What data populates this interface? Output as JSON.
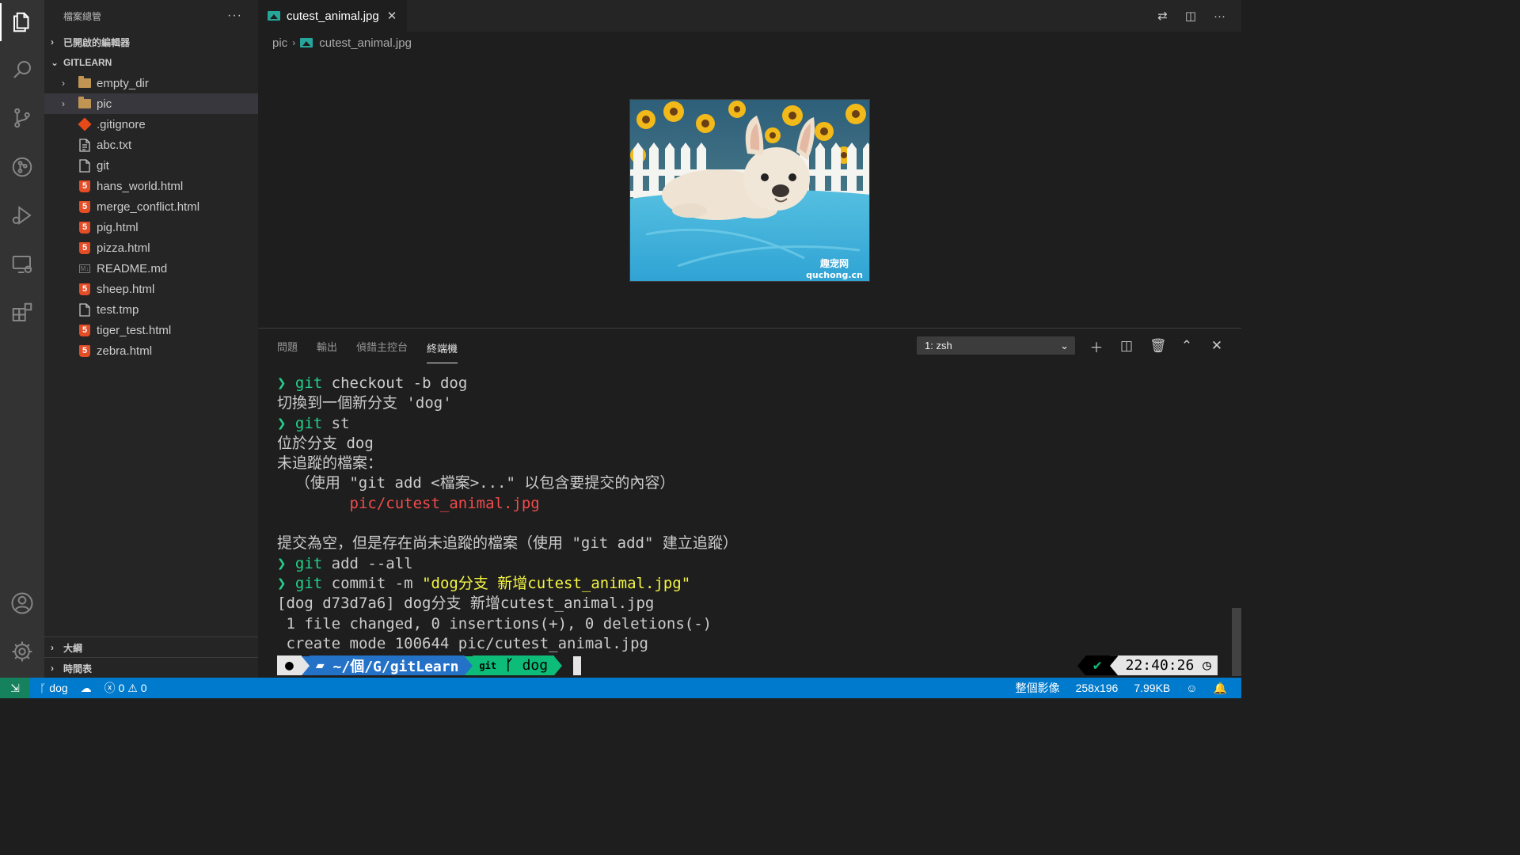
{
  "sidebar": {
    "title": "檔案總管",
    "more": "···",
    "open_editors": "已開啟的編輯器",
    "project": "GITLEARN",
    "outline": "大綱",
    "timeline": "時間表",
    "items": [
      {
        "name": "empty_dir",
        "type": "folder"
      },
      {
        "name": "pic",
        "type": "folder"
      },
      {
        "name": ".gitignore",
        "type": "git"
      },
      {
        "name": "abc.txt",
        "type": "text"
      },
      {
        "name": "git",
        "type": "file"
      },
      {
        "name": "hans_world.html",
        "type": "html"
      },
      {
        "name": "merge_conflict.html",
        "type": "html"
      },
      {
        "name": "pig.html",
        "type": "html"
      },
      {
        "name": "pizza.html",
        "type": "html"
      },
      {
        "name": "README.md",
        "type": "md"
      },
      {
        "name": "sheep.html",
        "type": "html"
      },
      {
        "name": "test.tmp",
        "type": "file"
      },
      {
        "name": "tiger_test.html",
        "type": "html"
      },
      {
        "name": "zebra.html",
        "type": "html"
      }
    ]
  },
  "editor": {
    "tab_label": "cutest_animal.jpg",
    "breadcrumb_folder": "pic",
    "breadcrumb_file": "cutest_animal.jpg",
    "image_watermark_line1": "趣宠网",
    "image_watermark_line2": "quchong.cn"
  },
  "panel": {
    "tabs": [
      "問題",
      "輸出",
      "偵錯主控台",
      "終端機"
    ],
    "terminal_select": "1: zsh"
  },
  "terminal": {
    "lines": {
      "l1_cmd": "git",
      "l1_rest": " checkout -b dog",
      "l2": "切換到一個新分支 'dog'",
      "l3_cmd": "git",
      "l3_rest": " st",
      "l4": "位於分支 dog",
      "l5": "未追蹤的檔案：",
      "l6": "  （使用 \"git add <檔案>...\" 以包含要提交的內容）",
      "l7": "pic/cutest_animal.jpg",
      "l8": "提交為空，但是存在尚未追蹤的檔案（使用 \"git add\" 建立追蹤）",
      "l9_cmd": "git",
      "l9_rest": " add --all",
      "l10_cmd": "git",
      "l10_mid": " commit -m ",
      "l10_msg": "\"dog分支 新增cutest_animal.jpg\"",
      "l11": "[dog d73d7a6] dog分支 新增cutest_animal.jpg",
      "l12": " 1 file changed, 0 insertions(+), 0 deletions(-)",
      "l13": " create mode 100644 pic/cutest_animal.jpg"
    },
    "prompt_symbol": "❯",
    "ps_dir": "~/個/G/gitLearn",
    "ps_git_label": "git",
    "ps_branch": "dog",
    "time": "22:40:26"
  },
  "statusbar": {
    "branch": "dog",
    "errors": "0",
    "warnings": "0",
    "image_mode": "整個影像",
    "dimensions": "258x196",
    "filesize": "7.99KB"
  },
  "colors": {
    "accent": "#007acc",
    "terminal_green": "#23d18b",
    "terminal_red": "#f14c4c",
    "terminal_yellow": "#f5f543",
    "html_icon": "#e44d26"
  }
}
